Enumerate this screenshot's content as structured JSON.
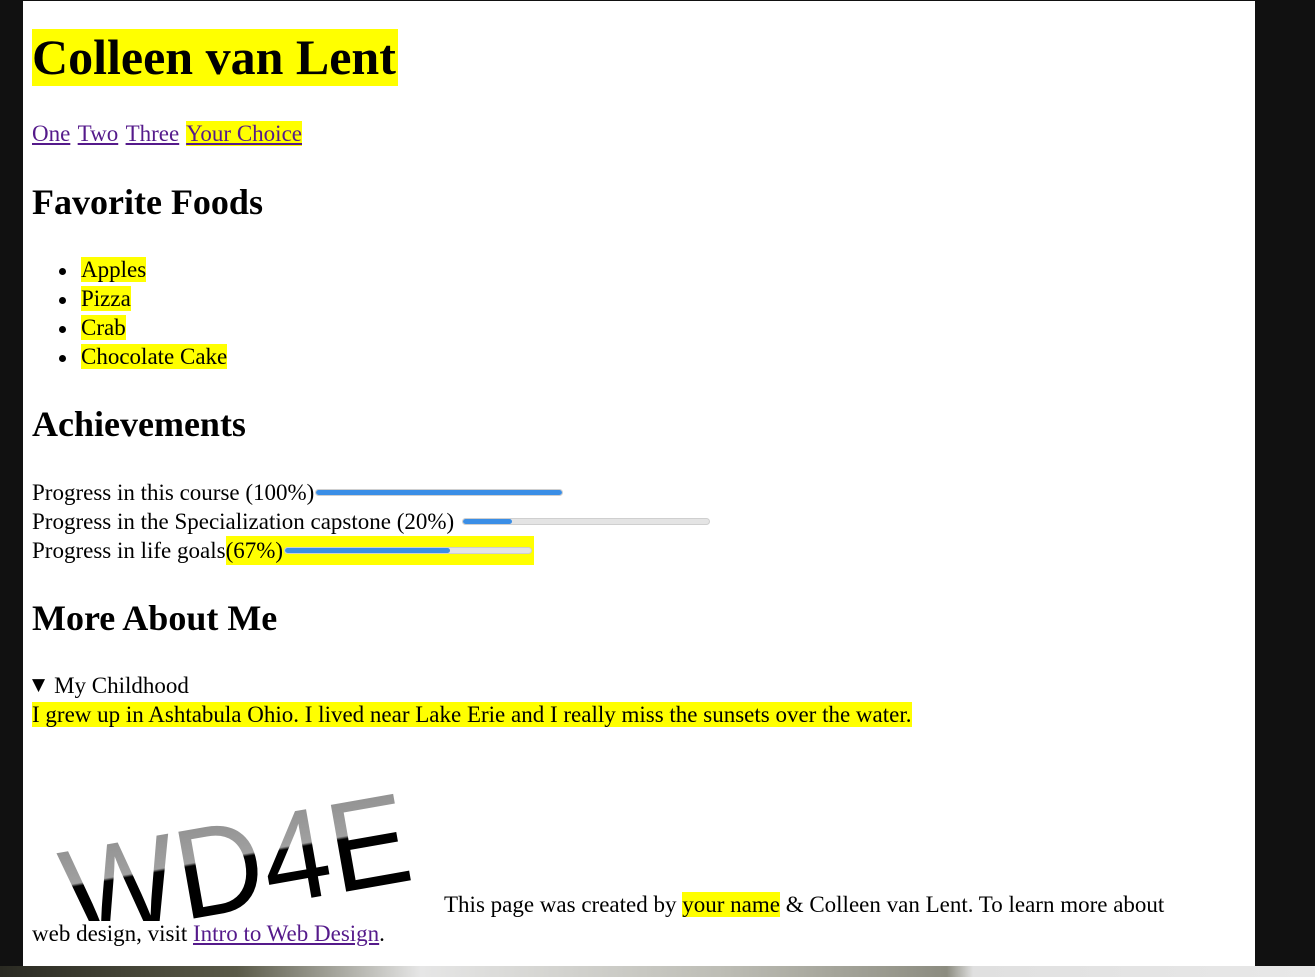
{
  "site_title": "Colleen van Lent",
  "nav": {
    "links": [
      "One",
      "Two",
      "Three",
      "Your Choice"
    ]
  },
  "foods": {
    "heading": "Favorite Foods",
    "items": [
      "Apples",
      "Pizza",
      "Crab",
      "Chocolate Cake"
    ]
  },
  "achievements": {
    "heading": "Achievements",
    "items": [
      {
        "label": "Progress in this course (100%)",
        "progress": 1.0
      },
      {
        "label": "Progress in the Specialization capstone (20%)",
        "progress": 0.2
      },
      {
        "label_prefix": "Progress in life goals ",
        "label_highlight": "(67%)",
        "progress": 0.67
      }
    ]
  },
  "about": {
    "heading": "More About Me",
    "summary": "My Childhood",
    "text": "I grew up in Ashtabula Ohio. I lived near Lake Erie and I really miss the sunsets over the water."
  },
  "footer": {
    "logo_text": "WD4E",
    "text_before": "This page was created by ",
    "highlight": "your name",
    "text_after": " & Colleen van Lent. To learn more about",
    "line2_before": "web design, visit ",
    "link": "Intro to Web Design",
    "line2_after": "."
  },
  "colors": {
    "highlight": "#ffff00",
    "progress_fill": "#3a8ee6",
    "link_visited": "#551a8b"
  }
}
